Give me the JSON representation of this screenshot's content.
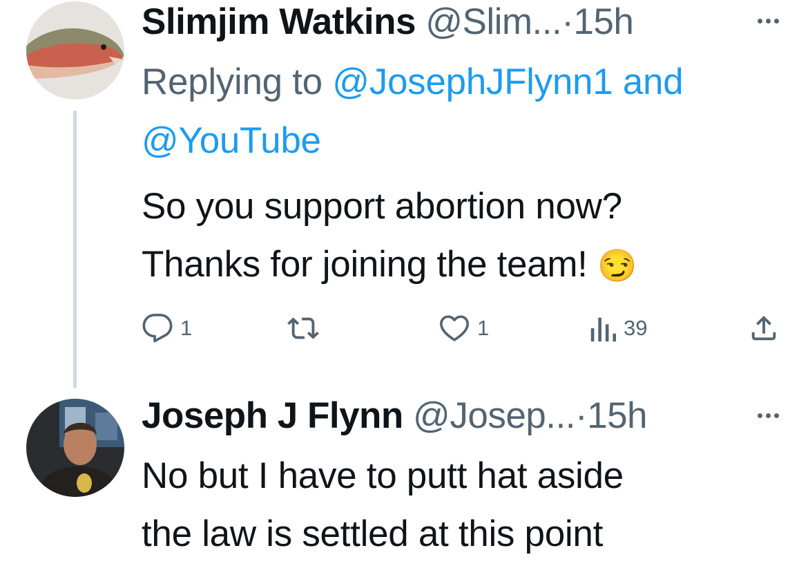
{
  "tweet1": {
    "name": "Slimjim Watkins",
    "handle": "@Slim...",
    "dot": "·",
    "time": "15h",
    "replying_prefix": "Replying to ",
    "mention1": "@JosephJFlynn1",
    "and_word": " and",
    "mention2": "@YouTube",
    "text_line1": "So you support abortion now?",
    "text_line2": "Thanks for joining the team!",
    "emoji": "😏",
    "actions": {
      "replies": "1",
      "likes": "1",
      "views": "39"
    }
  },
  "tweet2": {
    "name": "Joseph J Flynn",
    "handle": "@Josep...",
    "dot": "·",
    "time": "15h",
    "text_line1": "No but I have to putt hat aside",
    "text_line2": "the law is settled at this point"
  },
  "colors": {
    "text": "#0f1419",
    "secondary": "#536471",
    "link": "#1d9bf0",
    "thread": "#cfd9de"
  },
  "icons": [
    "reply-icon",
    "retweet-icon",
    "like-icon",
    "views-icon",
    "share-icon",
    "more-icon"
  ]
}
